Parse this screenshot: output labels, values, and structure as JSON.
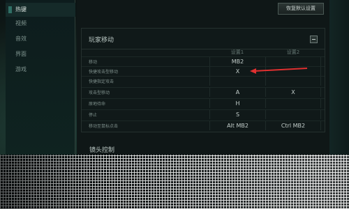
{
  "sidebar": {
    "items": [
      {
        "label": "热键",
        "active": true
      },
      {
        "label": "视频",
        "active": false
      },
      {
        "label": "音效",
        "active": false
      },
      {
        "label": "界面",
        "active": false
      },
      {
        "label": "游戏",
        "active": false
      }
    ]
  },
  "header": {
    "restore_button_label": "恢复默认设置"
  },
  "section_player_move": {
    "title": "玩家移动",
    "col1_label": "设置1",
    "col2_label": "设置2",
    "rows": [
      {
        "label": "移动",
        "v1": "MB2",
        "v2": ""
      },
      {
        "label": "快捷攻击型移动",
        "v1": "X",
        "v2": ""
      },
      {
        "label": "快捷指定攻击",
        "v1": "",
        "v2": ""
      },
      {
        "label": "攻击型移动",
        "v1": "A",
        "v2": "X"
      },
      {
        "label": "原地待命",
        "v1": "H",
        "v2": ""
      },
      {
        "label": "停止",
        "v1": "S",
        "v2": ""
      },
      {
        "label": "移动至鼠标点击",
        "v1": "Alt MB2",
        "v2": "Ctrl MB2"
      }
    ]
  },
  "section_camera": {
    "title": "镜头控制"
  },
  "colors": {
    "accent": "#2f6f65",
    "arrow": "#e03030"
  }
}
